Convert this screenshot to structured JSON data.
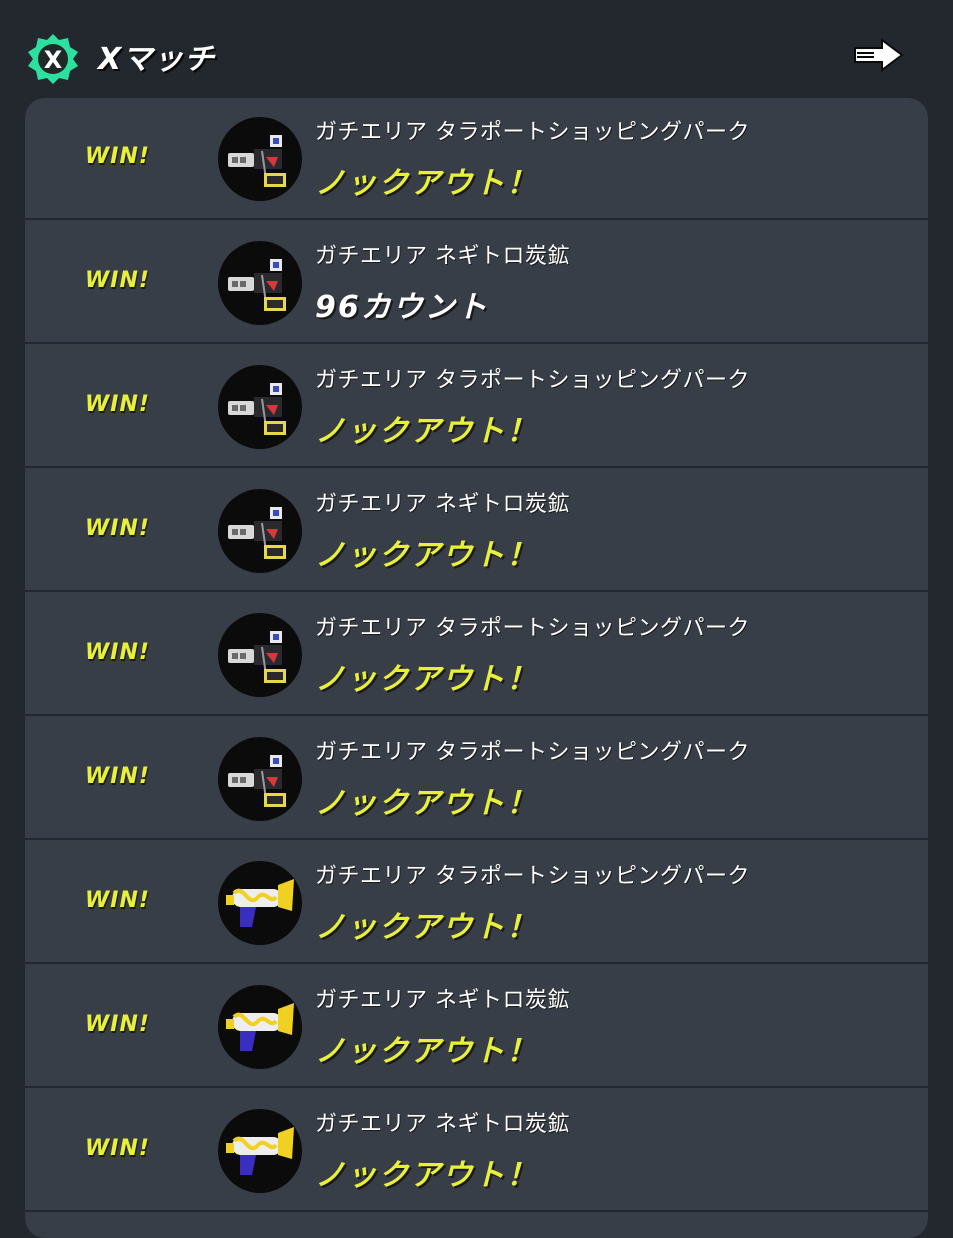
{
  "header": {
    "title": "Xマッチ",
    "badge_icon": "x-match-badge-icon",
    "badge_color": "#2ee0a0",
    "next_icon": "arrow-right-icon"
  },
  "colors": {
    "background": "#23272e",
    "panel": "#383e48",
    "win": "#e8f03a",
    "text": "#ffffff"
  },
  "battles": [
    {
      "result": "WIN!",
      "mode": "ガチエリア",
      "stage": "タラポートショッピングパーク",
      "outcome": "ノックアウト！",
      "outcome_type": "knockout",
      "weapon_icon": "splattershot-pro-nouveau-weapon-icon"
    },
    {
      "result": "WIN!",
      "mode": "ガチエリア",
      "stage": "ネギトロ炭鉱",
      "outcome": "96カウント",
      "outcome_type": "count",
      "weapon_icon": "splattershot-pro-nouveau-weapon-icon"
    },
    {
      "result": "WIN!",
      "mode": "ガチエリア",
      "stage": "タラポートショッピングパーク",
      "outcome": "ノックアウト！",
      "outcome_type": "knockout",
      "weapon_icon": "splattershot-pro-nouveau-weapon-icon"
    },
    {
      "result": "WIN!",
      "mode": "ガチエリア",
      "stage": "ネギトロ炭鉱",
      "outcome": "ノックアウト！",
      "outcome_type": "knockout",
      "weapon_icon": "splattershot-pro-nouveau-weapon-icon"
    },
    {
      "result": "WIN!",
      "mode": "ガチエリア",
      "stage": "タラポートショッピングパーク",
      "outcome": "ノックアウト！",
      "outcome_type": "knockout",
      "weapon_icon": "splattershot-pro-nouveau-weapon-icon"
    },
    {
      "result": "WIN!",
      "mode": "ガチエリア",
      "stage": "タラポートショッピングパーク",
      "outcome": "ノックアウト！",
      "outcome_type": "knockout",
      "weapon_icon": "splattershot-pro-nouveau-weapon-icon"
    },
    {
      "result": "WIN!",
      "mode": "ガチエリア",
      "stage": "タラポートショッピングパーク",
      "outcome": "ノックアウト！",
      "outcome_type": "knockout",
      "weapon_icon": "squeezer-weapon-icon"
    },
    {
      "result": "WIN!",
      "mode": "ガチエリア",
      "stage": "ネギトロ炭鉱",
      "outcome": "ノックアウト！",
      "outcome_type": "knockout",
      "weapon_icon": "squeezer-weapon-icon"
    },
    {
      "result": "WIN!",
      "mode": "ガチエリア",
      "stage": "ネギトロ炭鉱",
      "outcome": "ノックアウト！",
      "outcome_type": "knockout",
      "weapon_icon": "squeezer-weapon-icon"
    }
  ]
}
